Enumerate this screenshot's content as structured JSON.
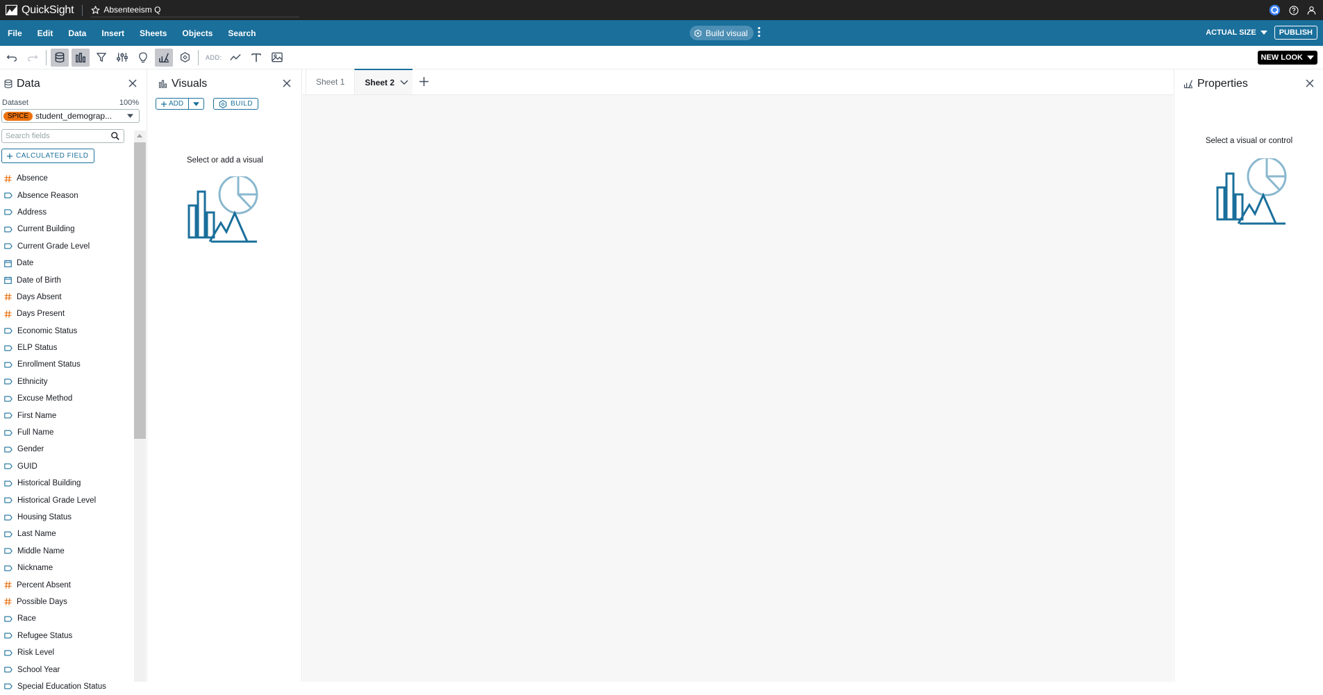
{
  "app": {
    "brand": "QuickSight",
    "analysis_name": "Absenteeism Q"
  },
  "menu": {
    "items": [
      "File",
      "Edit",
      "Data",
      "Insert",
      "Sheets",
      "Objects",
      "Search"
    ],
    "build_visual": "Build visual",
    "actual_size": "ACTUAL SIZE",
    "publish": "PUBLISH"
  },
  "toolbar": {
    "add_label": "ADD:",
    "new_look": "NEW LOOK"
  },
  "data_panel": {
    "title": "Data",
    "dataset_label": "Dataset",
    "dataset_pct": "100%",
    "spice_badge": "SPICE",
    "dataset_name": "student_demograp...",
    "search_placeholder": "Search fields",
    "calc_field": "CALCULATED FIELD",
    "fields": [
      {
        "name": "Absence",
        "type": "measure"
      },
      {
        "name": "Absence Reason",
        "type": "dimension"
      },
      {
        "name": "Address",
        "type": "dimension"
      },
      {
        "name": "Current Building",
        "type": "dimension"
      },
      {
        "name": "Current Grade Level",
        "type": "dimension"
      },
      {
        "name": "Date",
        "type": "date"
      },
      {
        "name": "Date of Birth",
        "type": "date"
      },
      {
        "name": "Days Absent",
        "type": "measure"
      },
      {
        "name": "Days Present",
        "type": "measure"
      },
      {
        "name": "Economic Status",
        "type": "dimension"
      },
      {
        "name": "ELP Status",
        "type": "dimension"
      },
      {
        "name": "Enrollment Status",
        "type": "dimension"
      },
      {
        "name": "Ethnicity",
        "type": "dimension"
      },
      {
        "name": "Excuse Method",
        "type": "dimension"
      },
      {
        "name": "First Name",
        "type": "dimension"
      },
      {
        "name": "Full Name",
        "type": "dimension"
      },
      {
        "name": "Gender",
        "type": "dimension"
      },
      {
        "name": "GUID",
        "type": "dimension"
      },
      {
        "name": "Historical Building",
        "type": "dimension"
      },
      {
        "name": "Historical Grade Level",
        "type": "dimension"
      },
      {
        "name": "Housing Status",
        "type": "dimension"
      },
      {
        "name": "Last Name",
        "type": "dimension"
      },
      {
        "name": "Middle Name",
        "type": "dimension"
      },
      {
        "name": "Nickname",
        "type": "dimension"
      },
      {
        "name": "Percent Absent",
        "type": "measure"
      },
      {
        "name": "Possible Days",
        "type": "measure"
      },
      {
        "name": "Race",
        "type": "dimension"
      },
      {
        "name": "Refugee Status",
        "type": "dimension"
      },
      {
        "name": "Risk Level",
        "type": "dimension"
      },
      {
        "name": "School Year",
        "type": "dimension"
      },
      {
        "name": "Special Education Status",
        "type": "dimension"
      }
    ]
  },
  "visuals_panel": {
    "title": "Visuals",
    "add": "ADD",
    "build": "BUILD",
    "empty_text": "Select or add a visual"
  },
  "sheets": {
    "tabs": [
      "Sheet 1",
      "Sheet 2"
    ],
    "active_index": 1
  },
  "properties_panel": {
    "title": "Properties",
    "empty_text": "Select a visual or control"
  },
  "colors": {
    "topbar": "#232323",
    "menubar": "#1a6f9b",
    "accent": "#1a6f9b",
    "measure_icon": "#ec7211",
    "dimension_icon": "#1a6f9b",
    "spice_badge": "#ec7211",
    "illustration_dark": "#1a6f9b",
    "illustration_light": "#8ab8cf"
  }
}
